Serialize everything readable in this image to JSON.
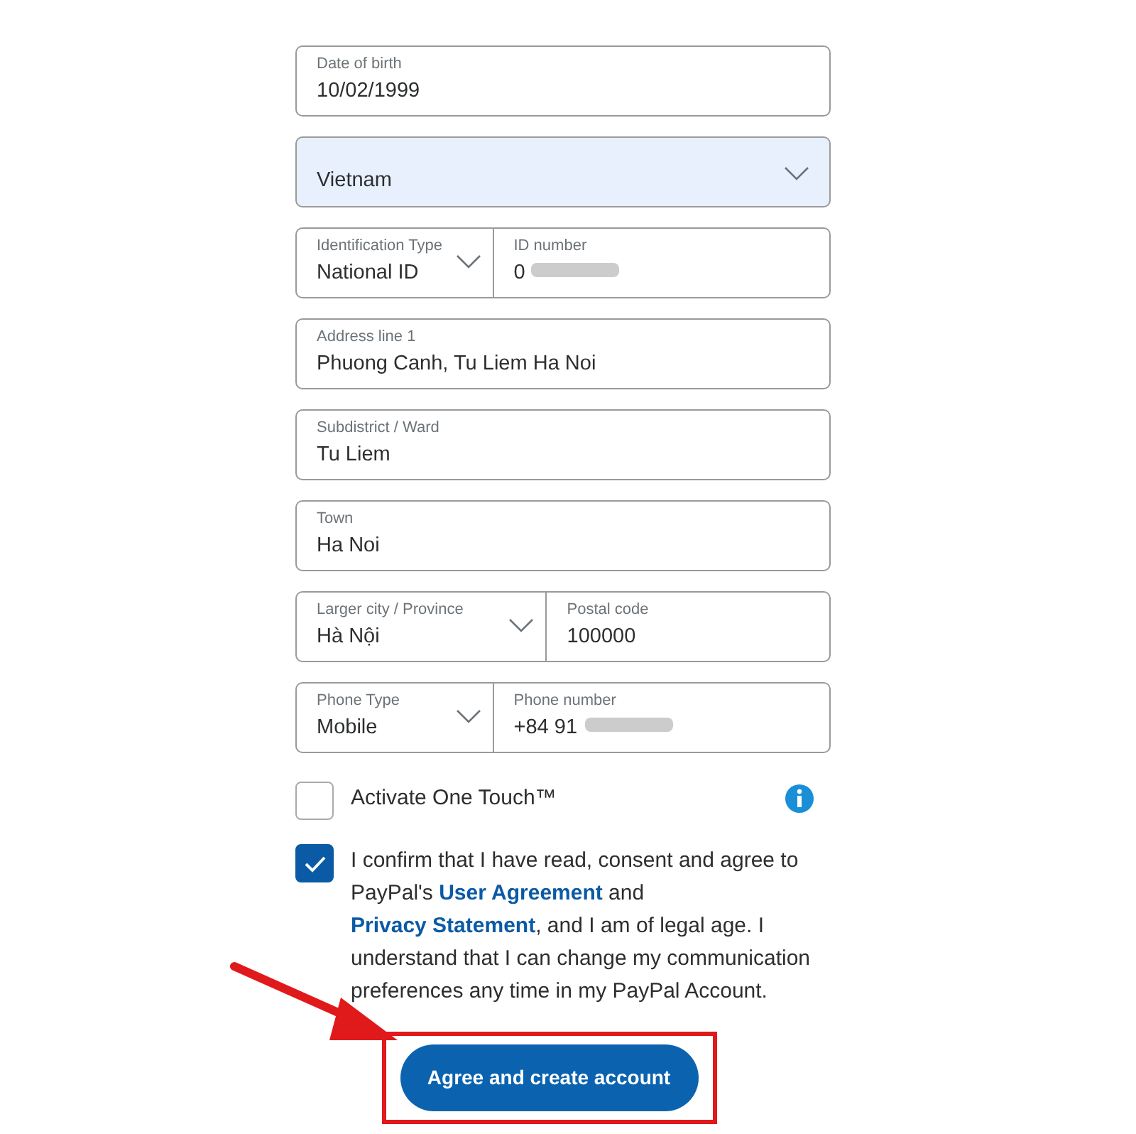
{
  "fields": [
    {
      "parts": [
        {
          "label": "Date of birth",
          "value": "10/02/1999"
        }
      ]
    },
    {
      "parts": [
        {
          "value": "Vietnam",
          "dropdown": true
        }
      ],
      "autofilled": true
    },
    {
      "parts": [
        {
          "label": "Identification Type",
          "value": "National ID",
          "dropdown": true
        },
        {
          "label": "ID number",
          "value": "0",
          "redacted": true
        }
      ]
    },
    {
      "parts": [
        {
          "label": "Address line 1",
          "value": "Phuong Canh, Tu Liem Ha Noi"
        }
      ]
    },
    {
      "parts": [
        {
          "label": "Subdistrict / Ward",
          "value": "Tu Liem"
        }
      ]
    },
    {
      "parts": [
        {
          "label": "Town",
          "value": "Ha Noi"
        }
      ]
    },
    {
      "parts": [
        {
          "label": "Larger city / Province",
          "value": "Hà Nội",
          "dropdown": true
        },
        {
          "label": "Postal code",
          "value": "100000"
        }
      ]
    },
    {
      "parts": [
        {
          "label": "Phone Type",
          "value": "Mobile",
          "dropdown": true
        },
        {
          "label": "Phone number",
          "value": "+84  91",
          "redacted": true
        }
      ]
    }
  ],
  "one_touch": {
    "label": "Activate One Touch™",
    "checked": false,
    "info": true
  },
  "consent": {
    "checked": true,
    "parts": [
      {
        "text": "I confirm that I have read, consent and agree to PayPal's ",
        "kind": "text"
      },
      {
        "text": "User Agreement",
        "kind": "link"
      },
      {
        "text": " and ",
        "kind": "text"
      },
      {
        "text": "Privacy Statement",
        "kind": "link"
      },
      {
        "text": ", and I am of legal age. I understand that I can change my communication preferences any time in my PayPal Account.",
        "kind": "text"
      }
    ]
  },
  "submit": {
    "label": "Agree and create account",
    "highlighted": true,
    "pointer_arrow": true
  }
}
